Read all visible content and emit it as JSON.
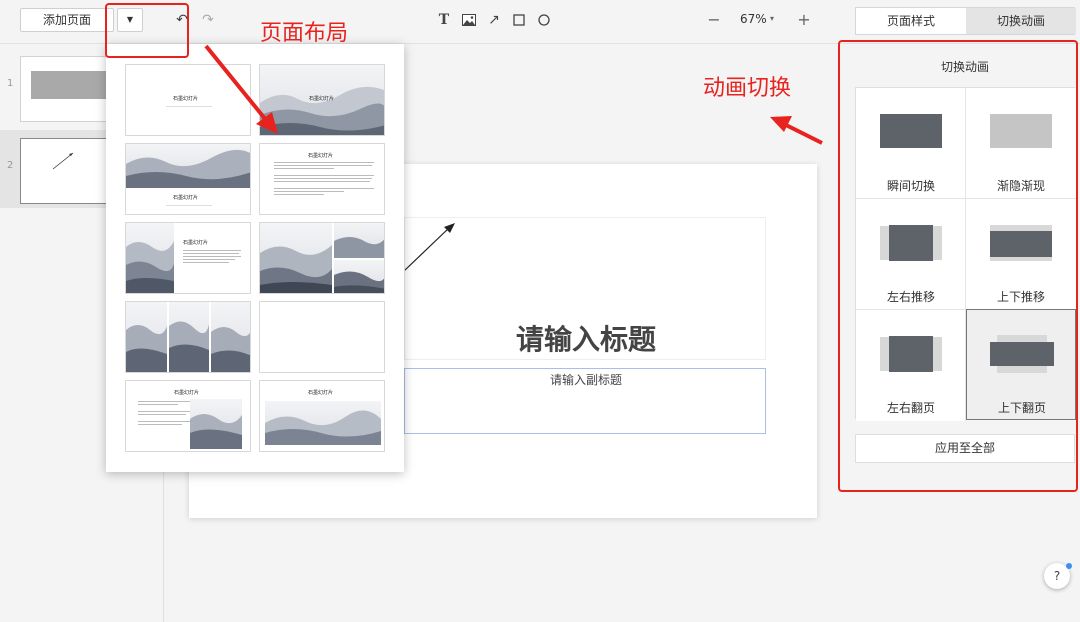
{
  "toolbar": {
    "add_page_label": "添加页面",
    "layout_toggle_glyph": "▼",
    "undo_glyph": "↶",
    "redo_glyph": "↷",
    "text_tool_glyph": "T",
    "line_tool_glyph": "↗",
    "zoom_minus": "−",
    "zoom_value": "67%",
    "zoom_caret": "▾",
    "zoom_plus": "+"
  },
  "panel_tabs": [
    "页面样式",
    "切换动画"
  ],
  "thumbnails": [
    {
      "number": "1"
    },
    {
      "number": "2"
    }
  ],
  "slide": {
    "title": "请输入标题",
    "subtitle": "请输入副标题"
  },
  "layouts": {
    "card_title": "石墨幻灯片"
  },
  "animation_panel": {
    "heading": "切换动画",
    "options": [
      {
        "label": "瞬间切换",
        "icon": "instant-switch-icon"
      },
      {
        "label": "渐隐渐现",
        "icon": "fade-icon"
      },
      {
        "label": "左右推移",
        "icon": "push-horizontal-icon"
      },
      {
        "label": "上下推移",
        "icon": "push-vertical-icon"
      },
      {
        "label": "左右翻页",
        "icon": "flip-horizontal-icon"
      },
      {
        "label": "上下翻页",
        "icon": "flip-vertical-icon"
      }
    ],
    "selected_index": 5,
    "apply_all_label": "应用至全部"
  },
  "help": {
    "glyph": "?"
  },
  "annotations": {
    "layout_label": "页面布局",
    "animation_label": "动画切换",
    "color": "#e8231f"
  }
}
